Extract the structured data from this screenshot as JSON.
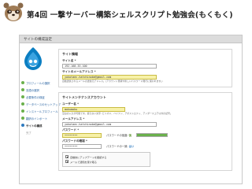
{
  "slide": {
    "title": "第4回 一撃サーバー構築シェルスクリプト勉強会(もくもく)"
  },
  "header": {
    "title": "サイトの構成設定"
  },
  "sidebar": {
    "steps": [
      {
        "label": "プロフィールの選択",
        "state": "done"
      },
      {
        "label": "言語の選択",
        "state": "done"
      },
      {
        "label": "必要条件の検証",
        "state": "done"
      },
      {
        "label": "データベースのセットアップ",
        "state": "done"
      },
      {
        "label": "インストールプロフィール",
        "state": "done"
      },
      {
        "label": "翻訳のインポート",
        "state": "done"
      },
      {
        "label": "サイトの構成",
        "state": "current"
      },
      {
        "label": "完了",
        "state": "todo"
      }
    ]
  },
  "form": {
    "site_info": {
      "legend": "サイト情報",
      "site_name_label": "サイト名 *",
      "site_name_value": "192.168.33.100",
      "site_email_label": "サイトのメールアドレス *",
      "site_email_value": "yokotaec.hatchinobe@gmail.com",
      "site_email_desc": "自動送信されるメールの送信元アドレス。(アカウント登録や新しいパスワード発行に使われます。)"
    },
    "maintenance": {
      "legend": "サイトメンテナンスアカウント",
      "username_label": "ユーザー名 *",
      "username_value": "mokumoku",
      "username_desc": "空白の入力が可能です。使えない文字: ピリオド、ハイフン、アポストロフィ、アンダースコア以外の記号。",
      "email_label": "メールアドレス *",
      "email_value": "yokotaec.hatchinobe@gmail.com",
      "password_label": "パスワード *",
      "password_value": "••••••••",
      "strength_label": "パスワードの強度:",
      "strength_value": "強",
      "strength_fill": 1.0,
      "confirm_label": "パスワードの確認 *",
      "confirm_value": "••••••••",
      "match_label": "パスワードの一致:",
      "match_value": "はい"
    },
    "notifications": {
      "options": [
        {
          "label": "自動的にアップデートを確認する",
          "checked": true
        },
        {
          "label": "メールで通知を受け取る",
          "checked": true
        }
      ]
    }
  },
  "colors": {
    "accent": "#2f7bc0",
    "done": "#6ab04c",
    "highlight": "#f7f1a8"
  }
}
